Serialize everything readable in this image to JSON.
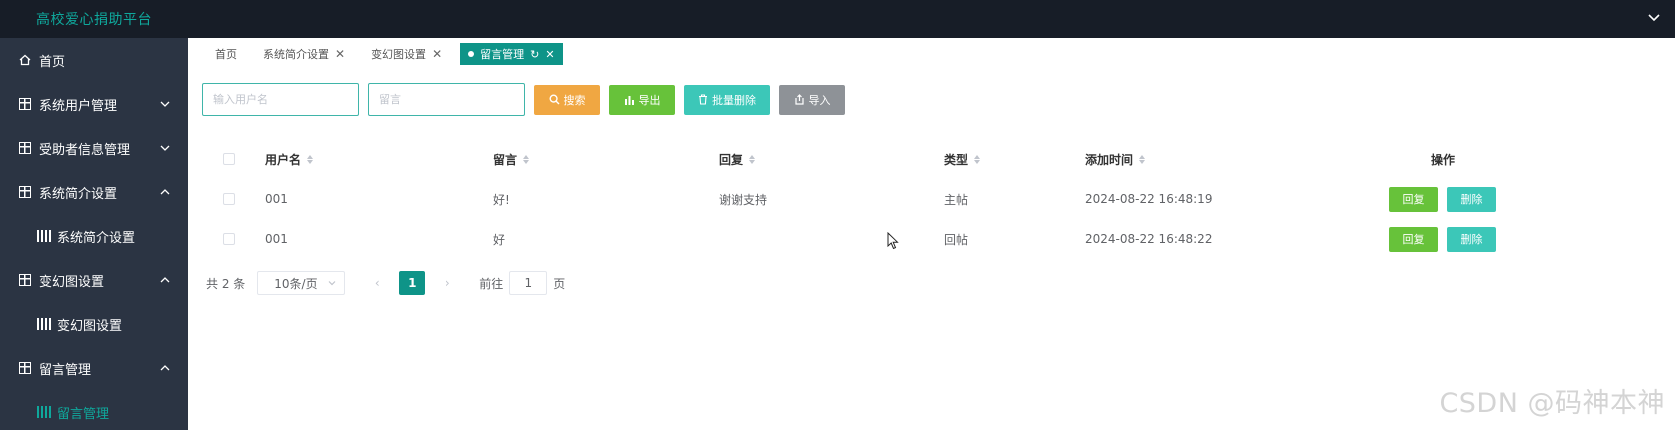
{
  "app": {
    "title": "高校爱心捐助平台"
  },
  "sidebar": {
    "items": [
      {
        "label": "首页"
      },
      {
        "label": "系统用户管理"
      },
      {
        "label": "受助者信息管理"
      },
      {
        "label": "系统简介设置"
      },
      {
        "label": "系统简介设置"
      },
      {
        "label": "变幻图设置"
      },
      {
        "label": "变幻图设置"
      },
      {
        "label": "留言管理"
      },
      {
        "label": "留言管理"
      }
    ]
  },
  "tabs": [
    {
      "label": "首页"
    },
    {
      "label": "系统简介设置"
    },
    {
      "label": "变幻图设置"
    },
    {
      "label": "留言管理"
    }
  ],
  "toolbar": {
    "username_placeholder": "输入用户名",
    "message_placeholder": "留言",
    "search_label": "搜索",
    "export_label": "导出",
    "bulk_delete_label": "批量删除",
    "import_label": "导入"
  },
  "table": {
    "columns": [
      "用户名",
      "留言",
      "回复",
      "类型",
      "添加时间",
      "操作"
    ],
    "rows": [
      {
        "username": "001",
        "message": "好!",
        "reply": "谢谢支持",
        "type": "主帖",
        "time": "2024-08-22 16:48:19",
        "reply_btn": "回复",
        "delete_btn": "删除"
      },
      {
        "username": "001",
        "message": "好",
        "reply": "",
        "type": "回帖",
        "time": "2024-08-22 16:48:22",
        "reply_btn": "回复",
        "delete_btn": "删除"
      }
    ]
  },
  "pagination": {
    "total_text": "共 2 条",
    "page_size": "10条/页",
    "current_page": "1",
    "goto_label": "前往",
    "goto_value": "1",
    "page_unit": "页"
  },
  "watermark": "CSDN @码神本神",
  "colors": {
    "accent": "#0e9488",
    "topbar": "#171d27",
    "sidebar": "#2b3443"
  }
}
